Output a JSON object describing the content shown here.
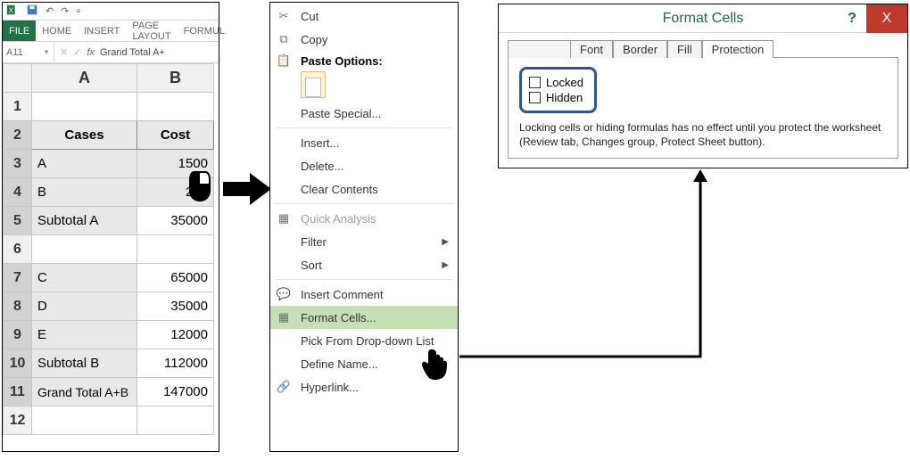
{
  "excel": {
    "qat_title": "",
    "tabs": {
      "file": "FILE",
      "home": "HOME",
      "insert": "INSERT",
      "page_layout": "PAGE LAYOUT",
      "formulas": "FORMUL"
    },
    "name_box": "A11",
    "fx": "fx",
    "formula_bar": "Grand Total A+",
    "col_headers": [
      "A",
      "B"
    ],
    "data_rows": [
      {
        "n": "1",
        "a": "",
        "b": ""
      },
      {
        "n": "2",
        "a": "Cases",
        "b": "Cost",
        "header": true
      },
      {
        "n": "3",
        "a": "A",
        "b": "1500"
      },
      {
        "n": "4",
        "a": "B",
        "b": "200"
      },
      {
        "n": "5",
        "a": "Subtotal A",
        "b": "35000"
      },
      {
        "n": "6",
        "a": "",
        "b": ""
      },
      {
        "n": "7",
        "a": "C",
        "b": "65000"
      },
      {
        "n": "8",
        "a": "D",
        "b": "35000"
      },
      {
        "n": "9",
        "a": "E",
        "b": "12000"
      },
      {
        "n": "10",
        "a": "Subtotal B",
        "b": "112000"
      },
      {
        "n": "11",
        "a": "Grand Total A+B",
        "b": "147000"
      },
      {
        "n": "12",
        "a": "",
        "b": ""
      }
    ]
  },
  "context_menu": {
    "cut": "Cut",
    "copy": "Copy",
    "paste_options": "Paste Options:",
    "paste_special": "Paste Special...",
    "insert": "Insert...",
    "delete": "Delete...",
    "clear_contents": "Clear Contents",
    "quick_analysis": "Quick Analysis",
    "filter": "Filter",
    "sort": "Sort",
    "insert_comment": "Insert Comment",
    "format_cells": "Format Cells...",
    "pick_from": "Pick From Drop-down List",
    "define_name": "Define Name...",
    "hyperlink": "Hyperlink..."
  },
  "dialog": {
    "title": "Format Cells",
    "help": "?",
    "close": "X",
    "tabs": {
      "font": "Font",
      "border": "Border",
      "fill": "Fill",
      "protection": "Protection"
    },
    "checks": {
      "locked": "Locked",
      "hidden": "Hidden"
    },
    "note": "Locking cells or hiding formulas has no effect until you protect the worksheet (Review tab, Changes group, Protect Sheet button)."
  }
}
